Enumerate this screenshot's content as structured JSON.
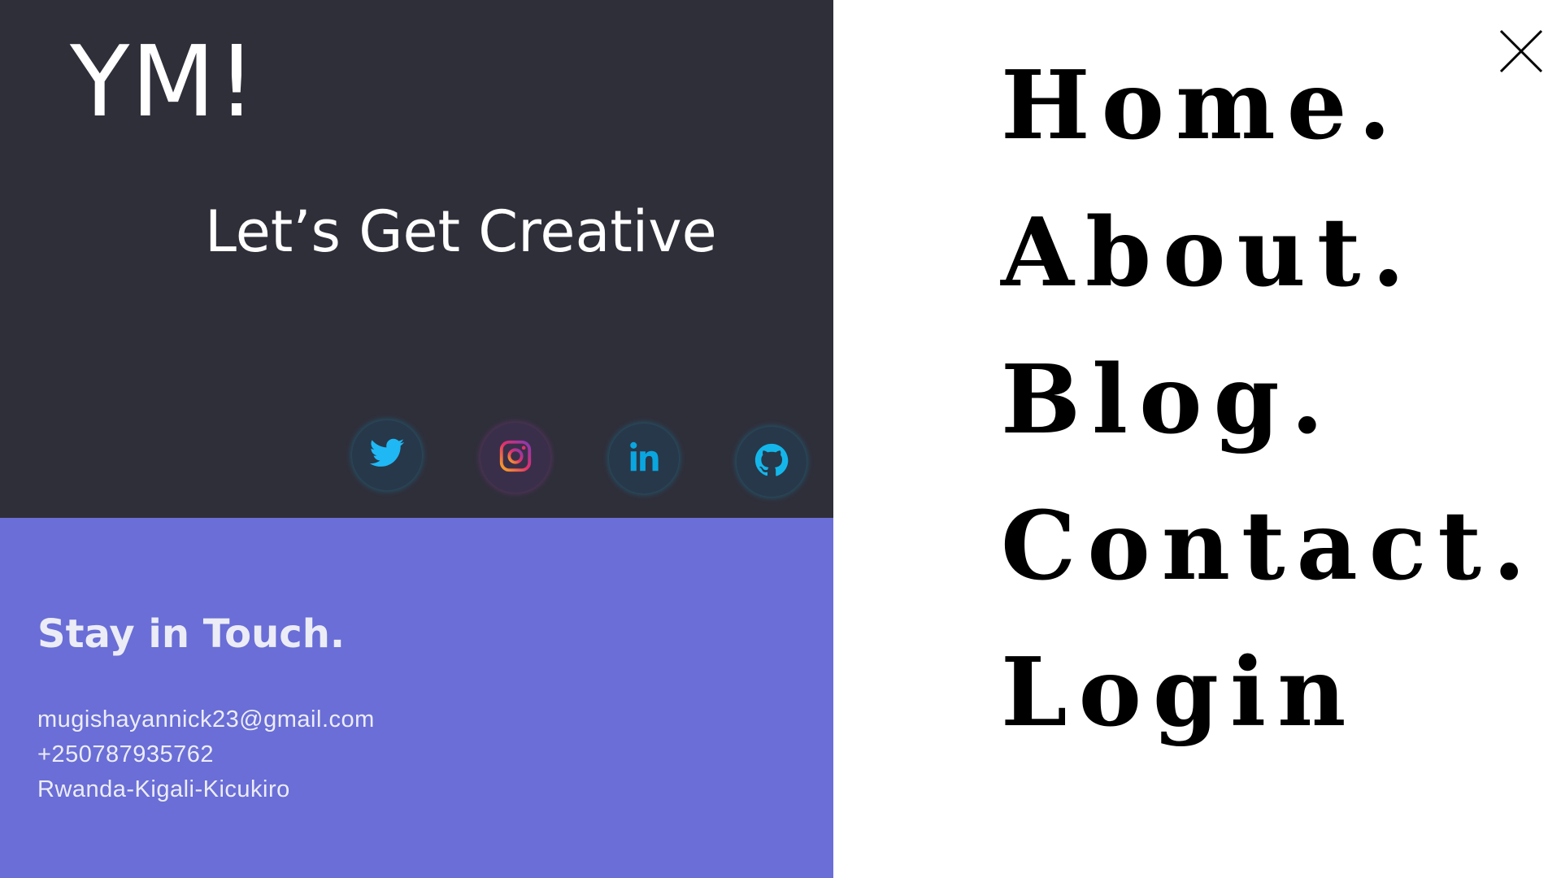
{
  "hero": {
    "logo": "YM!",
    "tagline": "Let’s Get Creative",
    "social": [
      {
        "name": "twitter",
        "icon": "twitter-icon",
        "color": "#1da1f2"
      },
      {
        "name": "instagram",
        "icon": "instagram-icon",
        "color": "#e1306c"
      },
      {
        "name": "linkedin",
        "icon": "linkedin-icon",
        "color": "#00a0dc"
      },
      {
        "name": "github",
        "icon": "github-icon",
        "color": "#00b4e6"
      }
    ]
  },
  "contact": {
    "title": "Stay in Touch.",
    "email": "mugishayannick23@gmail.com",
    "phone": "+250787935762",
    "address": "Rwanda-Kigali-Kicukiro"
  },
  "menu": {
    "items": [
      "Home.",
      "About.",
      "Blog.",
      "Contact.",
      "Login"
    ],
    "close_icon": "close-icon"
  },
  "colors": {
    "hero_bg": "#2f2f3a",
    "contact_bg": "#6a6ed6",
    "menu_bg": "#ffffff",
    "menu_text": "#000000"
  }
}
